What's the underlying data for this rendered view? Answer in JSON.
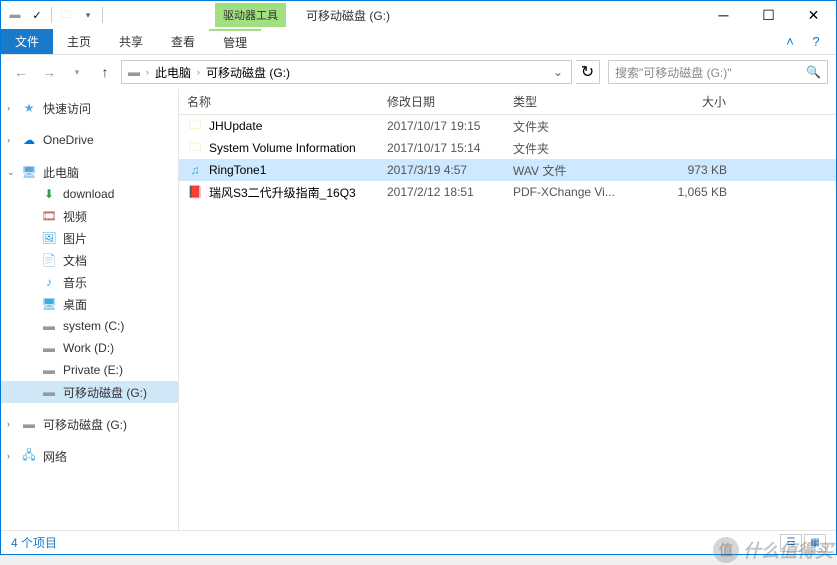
{
  "titlebar": {
    "tools_label": "驱动器工具",
    "title": "可移动磁盘 (G:)"
  },
  "ribbon": {
    "file": "文件",
    "home": "主页",
    "share": "共享",
    "view": "查看",
    "manage": "管理"
  },
  "address": {
    "segments": [
      "此电脑",
      "可移动磁盘 (G:)"
    ],
    "search_placeholder": "搜索\"可移动磁盘 (G:)\""
  },
  "sidebar": {
    "quick": "快速访问",
    "onedrive": "OneDrive",
    "thispc": "此电脑",
    "pc_children": [
      {
        "label": "download",
        "icon": "download"
      },
      {
        "label": "视频",
        "icon": "video"
      },
      {
        "label": "图片",
        "icon": "image"
      },
      {
        "label": "文档",
        "icon": "doc"
      },
      {
        "label": "音乐",
        "icon": "music"
      },
      {
        "label": "桌面",
        "icon": "desktop"
      },
      {
        "label": "system (C:)",
        "icon": "drive"
      },
      {
        "label": "Work (D:)",
        "icon": "drive"
      },
      {
        "label": "Private (E:)",
        "icon": "drive"
      },
      {
        "label": "可移动磁盘 (G:)",
        "icon": "drive",
        "selected": true
      }
    ],
    "removable": "可移动磁盘 (G:)",
    "network": "网络"
  },
  "columns": {
    "name": "名称",
    "date": "修改日期",
    "type": "类型",
    "size": "大小"
  },
  "files": [
    {
      "name": "JHUpdate",
      "date": "2017/10/17 19:15",
      "type": "文件夹",
      "size": "",
      "icon": "folder"
    },
    {
      "name": "System Volume Information",
      "date": "2017/10/17 15:14",
      "type": "文件夹",
      "size": "",
      "icon": "folder"
    },
    {
      "name": "RingTone1",
      "date": "2017/3/19 4:57",
      "type": "WAV 文件",
      "size": "973 KB",
      "icon": "wav",
      "selected": true
    },
    {
      "name": "瑞风S3二代升级指南_16Q3",
      "date": "2017/2/12 18:51",
      "type": "PDF-XChange Vi...",
      "size": "1,065 KB",
      "icon": "pdf"
    }
  ],
  "status": {
    "count": "4 个项目"
  },
  "watermark": {
    "badge": "值",
    "text": "什么值得买"
  }
}
